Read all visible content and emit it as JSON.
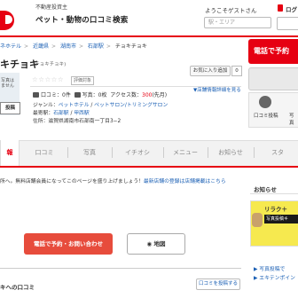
{
  "header": {
    "tagline": "不動産投資主",
    "site_name": "ペット・動物の口コミ検索",
    "welcome": "ようこそゲストさん",
    "login": "ログ",
    "area_placeholder": "駅・エリア"
  },
  "breadcrumb": {
    "items": [
      "ネホテル",
      "近畿県",
      "湖南市",
      "石部駅"
    ],
    "current": "チョキチョキ"
  },
  "shop": {
    "name": "キチョキ",
    "kana": "(チョキチョキ)",
    "photo_label": "写真は\nません",
    "photo_button": "投稿",
    "stars": "☆☆☆☆☆",
    "rating_label": "評価対象",
    "favorite_button": "お気に入り追加",
    "favorite_count": "0",
    "info_link": "▼店舗情報詳細を見る",
    "stats": {
      "reviews_label": "口コミ：0件",
      "photos_label": "写真：0枚",
      "access_label": "アクセス数：",
      "access_value": "300",
      "access_suffix": "(先月)"
    },
    "genre_label": "ジャンル：",
    "genre_items": [
      "ペットホテル",
      "ペットサロン/トリミングサロン"
    ],
    "station_label": "最寄駅：",
    "station_items": [
      "石部駅",
      "甲西駅"
    ],
    "address": "住所：滋賀県湖南市石部南一丁目3−2"
  },
  "right_panel": {
    "call_button": "電話で予約",
    "review_post": "口コミ投稿",
    "photo_post": "写真"
  },
  "tabs": [
    "報",
    "口コミ",
    "写真",
    "イチオシ",
    "メニュー",
    "お知らせ",
    "スタ"
  ],
  "notice": {
    "text": "所へ。無料店舗会員になってこのページを盛り上げましょう！",
    "link": "最新店舗の登録は店舗掲載はこちら"
  },
  "actions": {
    "call_reserve": "電話で予約・お問い合わせ",
    "map": "地図"
  },
  "reviews": {
    "title": "キへの口コミ",
    "post_button": "口コミを投稿する"
  },
  "sidebar": {
    "title": "お知らせ",
    "banner_title": "リラク＋",
    "banner_sub": "写真投稿キ",
    "links": [
      "▶ 写真投稿で",
      "▶ エキテンポイン"
    ]
  },
  "colors": {
    "brand_red": "#e60012",
    "link_blue": "#1a5fb4",
    "cta_red": "#e74c3c"
  }
}
